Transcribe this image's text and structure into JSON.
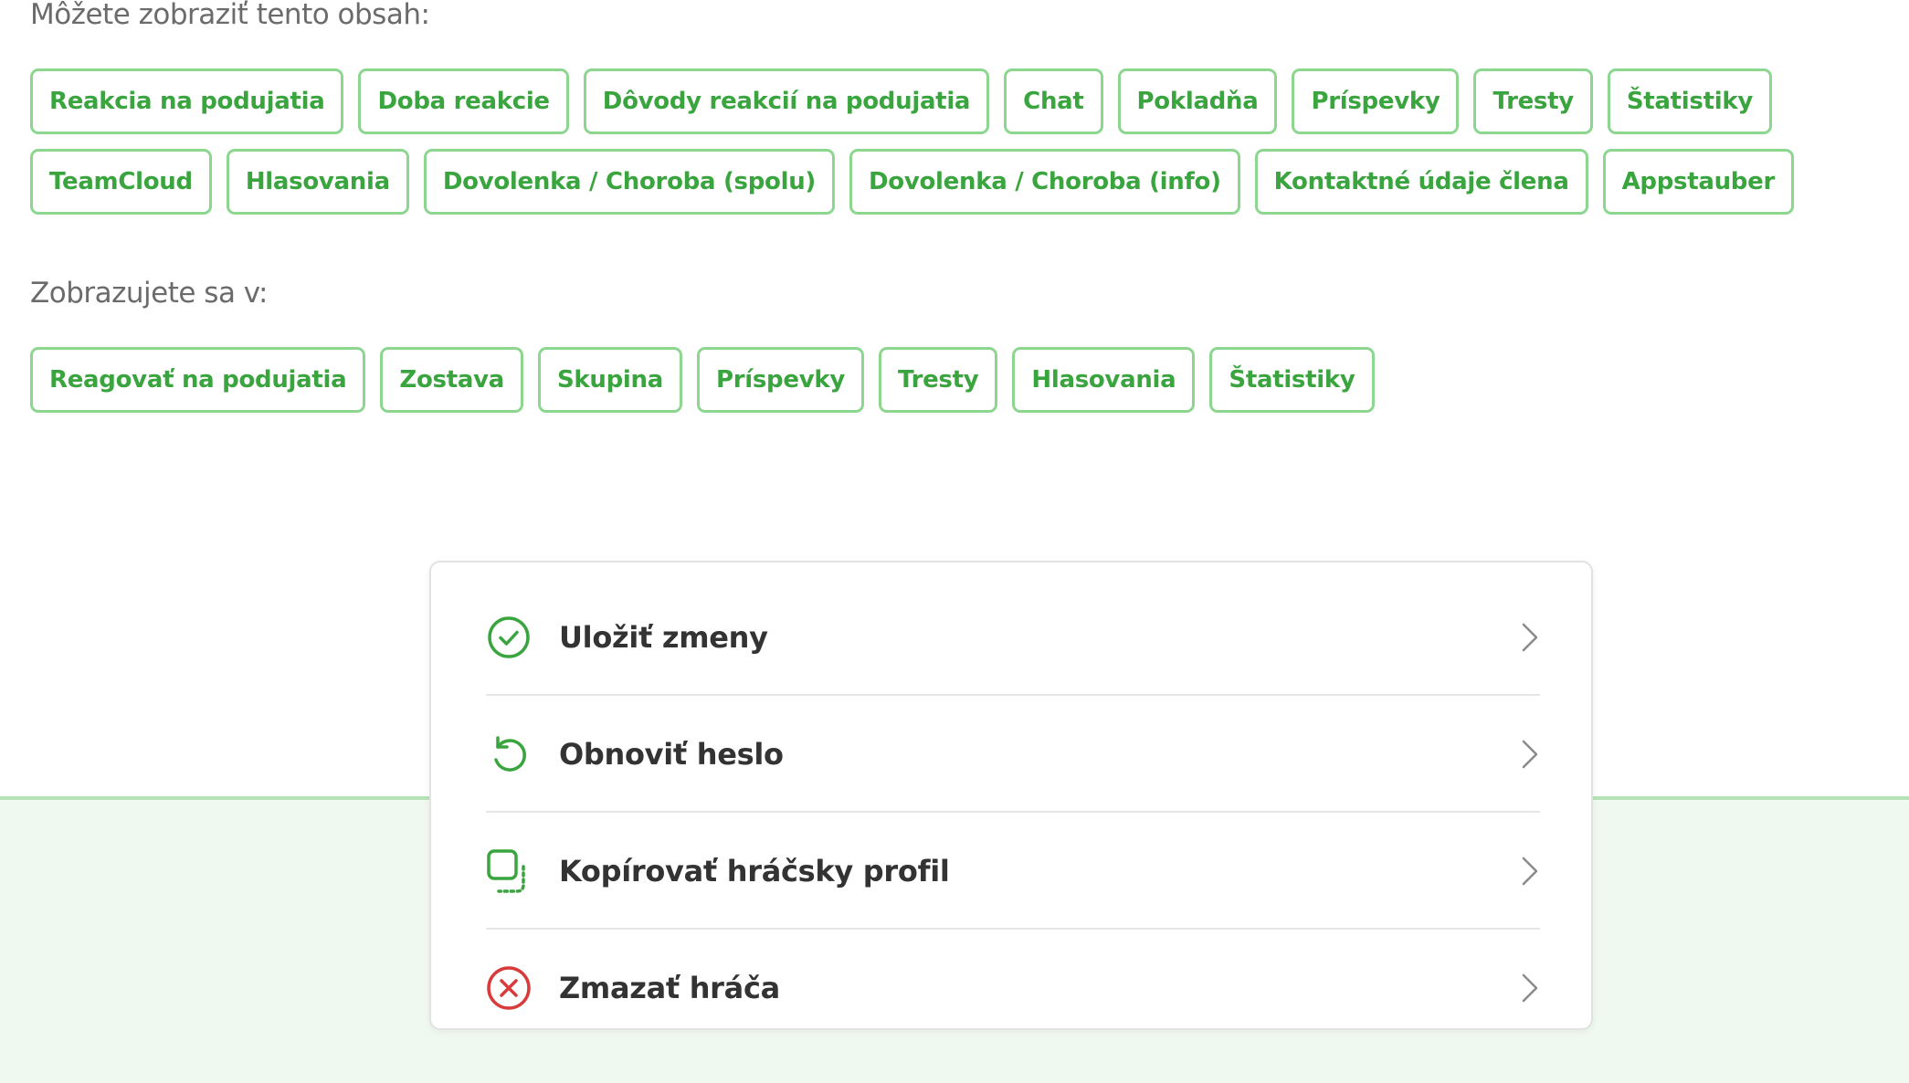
{
  "colors": {
    "accent_green": "#3aa53f",
    "chip_border": "#8cd68f",
    "danger_red": "#d93b3b",
    "footer_band": "#f0f9f0"
  },
  "content_access": {
    "label": "Môžete zobraziť tento obsah:",
    "chips": [
      "Reakcia na podujatia",
      "Doba reakcie",
      "Dôvody reakcií na podujatia",
      "Chat",
      "Pokladňa",
      "Príspevky",
      "Tresty",
      "Štatistiky",
      "TeamCloud",
      "Hlasovania",
      "Dovolenka / Choroba (spolu)",
      "Dovolenka / Choroba (info)",
      "Kontaktné údaje člena",
      "Appstauber"
    ]
  },
  "visibility": {
    "label": "Zobrazujete sa v:",
    "chips": [
      "Reagovať na podujatia",
      "Zostava",
      "Skupina",
      "Príspevky",
      "Tresty",
      "Hlasovania",
      "Štatistiky"
    ]
  },
  "actions": [
    {
      "label": "Uložiť zmeny",
      "icon": "check-circle-icon"
    },
    {
      "label": "Obnoviť heslo",
      "icon": "reset-arrow-icon"
    },
    {
      "label": "Kopírovať hráčsky profil",
      "icon": "copy-icon"
    },
    {
      "label": "Zmazať hráča",
      "icon": "delete-circle-icon"
    }
  ]
}
